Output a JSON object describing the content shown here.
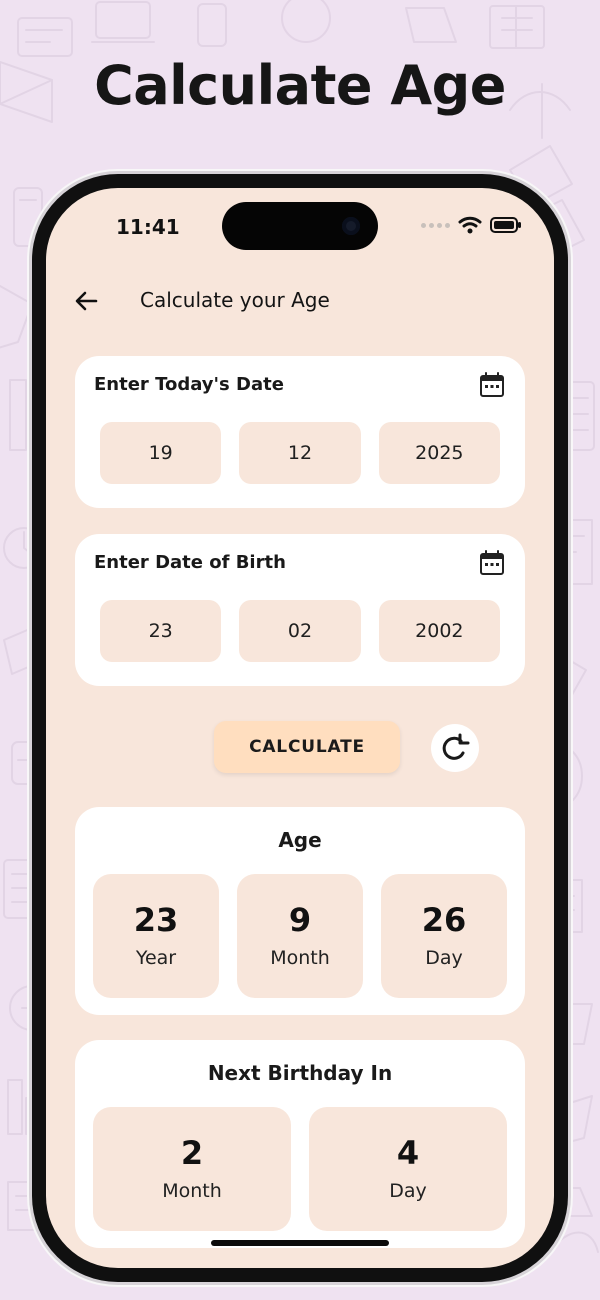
{
  "promo": {
    "headline": "Calculate Age"
  },
  "status": {
    "time": "11:41"
  },
  "header": {
    "title": "Calculate your Age"
  },
  "today_date": {
    "label": "Enter Today's Date",
    "day": "19",
    "month": "12",
    "year": "2025"
  },
  "birth_date": {
    "label": "Enter Date of Birth",
    "day": "23",
    "month": "02",
    "year": "2002"
  },
  "actions": {
    "calculate_label": "CALCULATE"
  },
  "age": {
    "title": "Age",
    "items": [
      {
        "value": "23",
        "unit": "Year"
      },
      {
        "value": "9",
        "unit": "Month"
      },
      {
        "value": "26",
        "unit": "Day"
      }
    ]
  },
  "next_birthday": {
    "title": "Next Birthday In",
    "items": [
      {
        "value": "2",
        "unit": "Month"
      },
      {
        "value": "4",
        "unit": "Day"
      }
    ]
  },
  "colors": {
    "background": "#efe2f1",
    "screen": "#f8e6db",
    "card": "#ffffff",
    "button": "#ffdebf",
    "text": "#161616"
  },
  "icons": {
    "back": "arrow-left-icon",
    "calendar": "calendar-icon",
    "reset": "refresh-icon",
    "wifi": "wifi-icon",
    "battery": "battery-icon"
  }
}
